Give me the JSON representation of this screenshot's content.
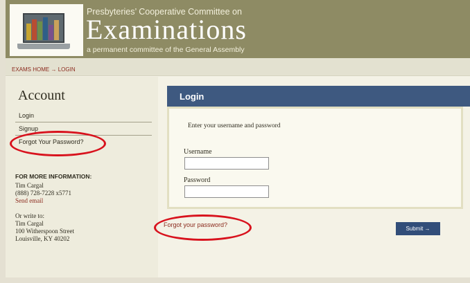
{
  "header": {
    "org_line1": "Presbyteries’ Cooperative Committee on",
    "org_line2": "Examinations",
    "org_line3": "a permanent committee of the General Assembly"
  },
  "breadcrumb": {
    "home_label": "EXAMS HOME",
    "separator": "→",
    "current": "LOGIN"
  },
  "sidebar": {
    "title": "Account",
    "links": [
      "Login",
      "Signup",
      "Forgot Your Password?"
    ],
    "info_heading": "FOR MORE INFORMATION:",
    "contact_name": "Tim Cargal",
    "contact_phone": "(888) 728-7228 x5771",
    "send_email": "Send email",
    "write_to": "Or write to:",
    "address_name": "Tim Cargal",
    "address_street": "100 Witherspoon Street",
    "address_city": "Louisville, KY 40202"
  },
  "login": {
    "title": "Login",
    "instruction": "Enter your username and password",
    "username_label": "Username",
    "username_value": "",
    "password_label": "Password",
    "password_value": "",
    "forgot_label": "Forgot your password?",
    "submit_label": "Submit →"
  },
  "colors": {
    "banner": "#8e8b64",
    "panel_header": "#3e5980",
    "link": "#8b2a1d",
    "callout": "#d8121d"
  }
}
